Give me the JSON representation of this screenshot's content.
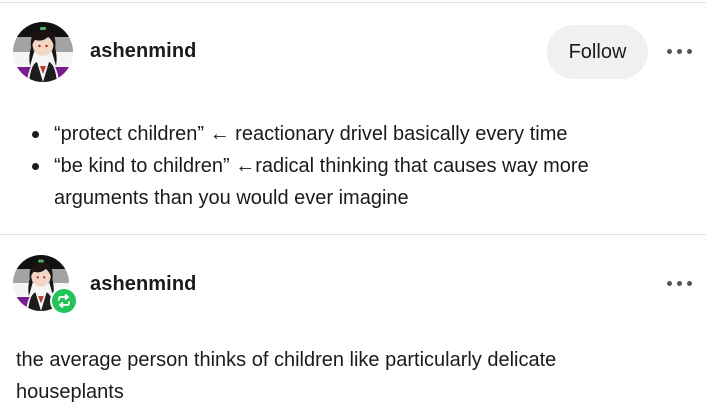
{
  "post1": {
    "username": "ashenmind",
    "follow_label": "Follow",
    "avatar_icon": "user-avatar",
    "more_icon": "more-options-icon",
    "bullets": [
      "“protect children” ← reactionary drivel basically every time",
      "“be kind to children” ←radical thinking that causes way more arguments than you would ever imagine"
    ]
  },
  "post2": {
    "username": "ashenmind",
    "avatar_icon": "user-avatar",
    "badge_icon": "reblog-icon",
    "more_icon": "more-options-icon",
    "text": "the average person thinks of children like particularly delicate houseplants"
  },
  "colors": {
    "reblog_badge": "#22c35a",
    "follow_bg": "#f0f0f0",
    "flag_purple": "#7a1c8f",
    "flag_gray": "#a3a3a3"
  }
}
